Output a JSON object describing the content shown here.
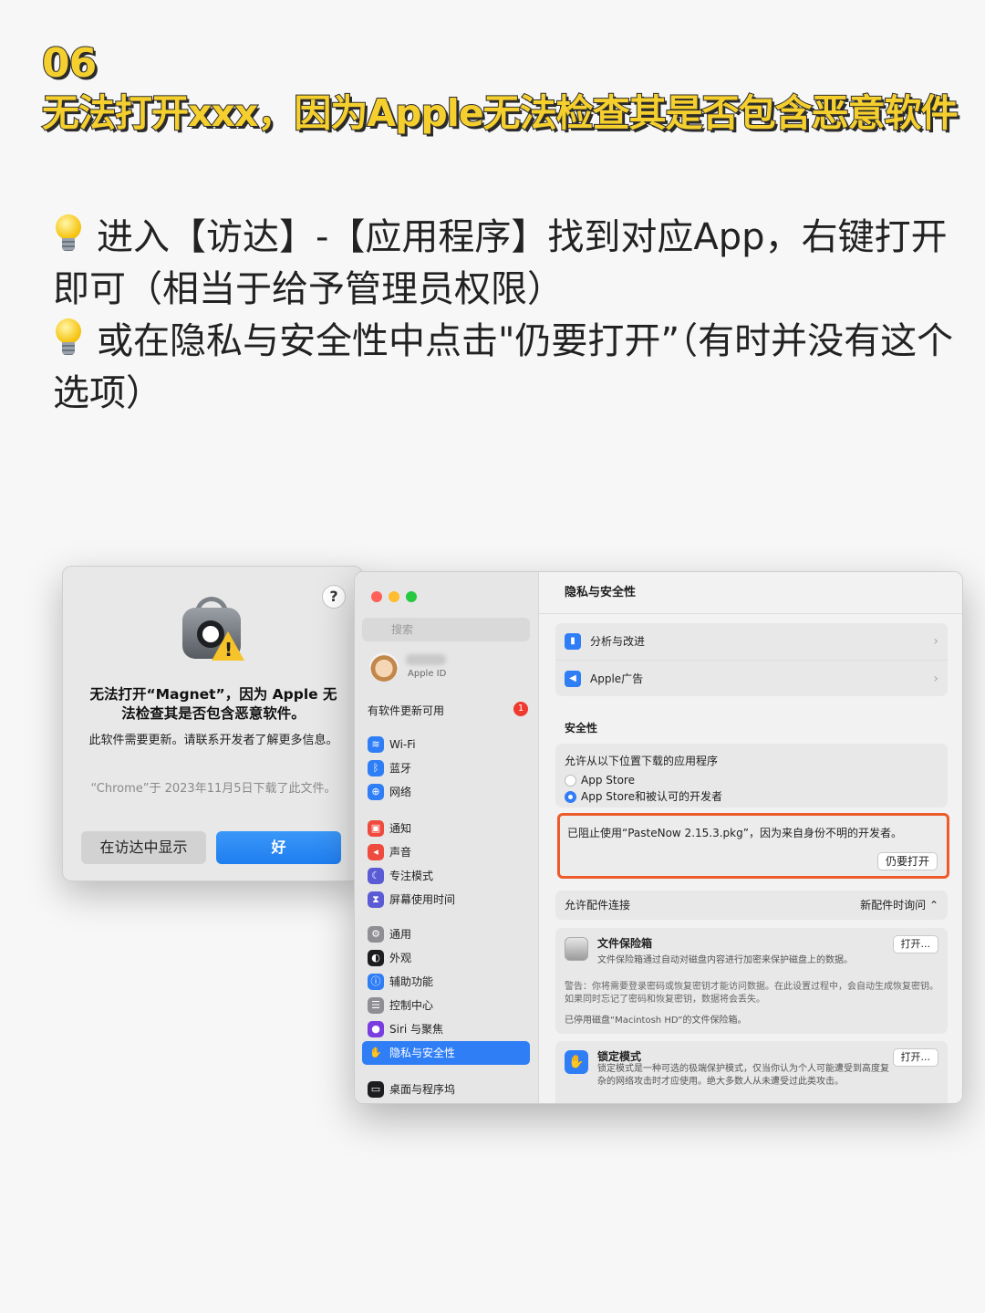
{
  "headline": {
    "number": "06",
    "title": "无法打开xxx，因为Apple无法检查其是否包含恶意软件"
  },
  "tips": [
    "进入【访达】-【应用程序】找到对应App，右键打开即可（相当于给予管理员权限）",
    "或在隐私与安全性中点击\"仍要打开”（有时并没有这个选项）"
  ],
  "alert": {
    "help": "?",
    "title": "无法打开“Magnet”，因为 Apple 无法检查其是否包含恶意软件。",
    "message": "此软件需要更新。请联系开发者了解更多信息。",
    "source": "“Chrome”于 2023年11月5日下载了此文件。",
    "btn_show_in_finder": "在访达中显示",
    "btn_ok": "好",
    "warn_mark": "!"
  },
  "settings": {
    "search_placeholder": "搜索",
    "account_sub": "Apple ID",
    "update_label": "有软件更新可用",
    "update_badge": "1",
    "nav_groups": [
      [
        {
          "label": "Wi-Fi",
          "icon": "wifi-icon",
          "glyph": "≋",
          "color": "#2f7ef5"
        },
        {
          "label": "蓝牙",
          "icon": "bluetooth-icon",
          "glyph": "ᛒ",
          "color": "#2f7ef5"
        },
        {
          "label": "网络",
          "icon": "globe-icon",
          "glyph": "⊕",
          "color": "#2f7ef5"
        }
      ],
      [
        {
          "label": "通知",
          "icon": "bell-icon",
          "glyph": "▣",
          "color": "#ef4a3e"
        },
        {
          "label": "声音",
          "icon": "speaker-icon",
          "glyph": "◂",
          "color": "#ef4a3e"
        },
        {
          "label": "专注模式",
          "icon": "moon-icon",
          "glyph": "☾",
          "color": "#5b5bd6"
        },
        {
          "label": "屏幕使用时间",
          "icon": "hourglass-icon",
          "glyph": "⧗",
          "color": "#5b5bd6"
        }
      ],
      [
        {
          "label": "通用",
          "icon": "gear-icon",
          "glyph": "⚙",
          "color": "#8e8e93"
        },
        {
          "label": "外观",
          "icon": "appearance-icon",
          "glyph": "◐",
          "color": "#1d1d1f"
        },
        {
          "label": "辅助功能",
          "icon": "accessibility-icon",
          "glyph": "ⓘ",
          "color": "#2f7ef5"
        },
        {
          "label": "控制中心",
          "icon": "control-center-icon",
          "glyph": "☰",
          "color": "#8e8e93"
        },
        {
          "label": "Siri 与聚焦",
          "icon": "siri-icon",
          "glyph": "●",
          "color": "#7a3de0"
        },
        {
          "label": "隐私与安全性",
          "icon": "hand-icon",
          "glyph": "✋",
          "color": "#2f7ef5",
          "active": true
        }
      ],
      [
        {
          "label": "桌面与程序坞",
          "icon": "dock-icon",
          "glyph": "▭",
          "color": "#1d1d1f"
        }
      ]
    ],
    "main_title": "隐私与安全性",
    "top_rows": [
      {
        "label": "分析与改进",
        "icon": "chart-icon",
        "glyph": "▮"
      },
      {
        "label": "Apple广告",
        "icon": "megaphone-icon",
        "glyph": "◀"
      }
    ],
    "security_label": "安全性",
    "allow_label": "允许从以下位置下载的应用程序",
    "allow_options": [
      {
        "label": "App Store",
        "selected": false
      },
      {
        "label": "App Store和被认可的开发者",
        "selected": true
      }
    ],
    "blocked_text": "已阻止使用“PasteNow 2.15.3.pkg”，因为来自身份不明的开发者。",
    "open_anyway": "仍要打开",
    "accessory_label": "允许配件连接",
    "accessory_value": "新配件时询问 ⌃",
    "filevault": {
      "name": "文件保险箱",
      "desc": "文件保险箱通过自动对磁盘内容进行加密来保护磁盘上的数据。",
      "button": "打开...",
      "warning": "警告：你将需要登录密码或恢复密钥才能访问数据。在此设置过程中，会自动生成恢复密钥。如果同时忘记了密码和恢复密钥，数据将会丢失。",
      "status": "已停用磁盘“Macintosh HD”的文件保险箱。"
    },
    "lockdown": {
      "name": "锁定模式",
      "desc": "锁定模式是一种可选的极端保护模式，仅当你认为个人可能遭受到高度复杂的网络攻击时才应使用。绝大多数人从未遭受过此类攻击。",
      "button": "打开..."
    }
  }
}
